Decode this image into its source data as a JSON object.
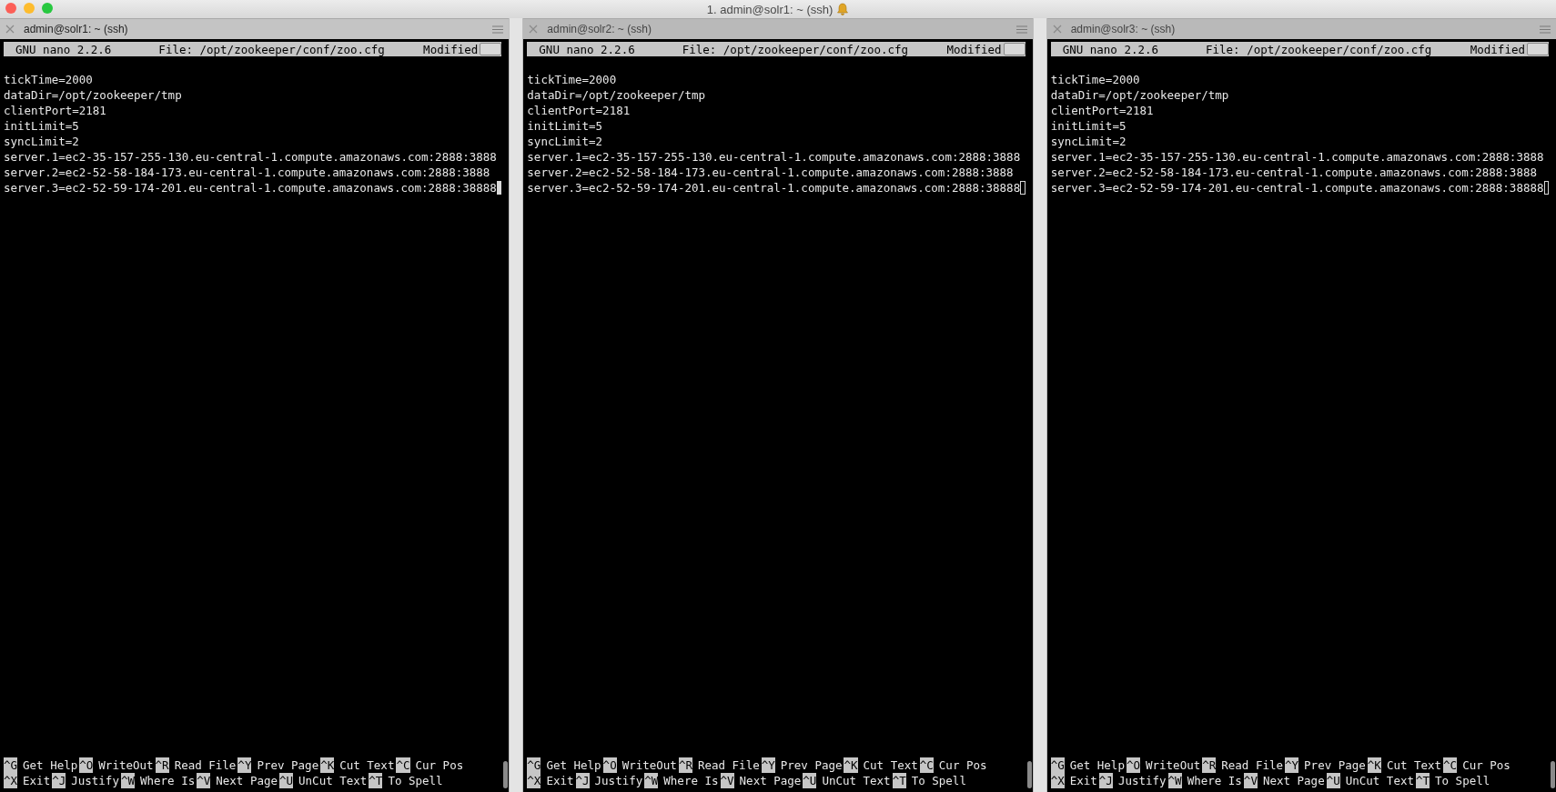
{
  "window": {
    "title": "1. admin@solr1: ~ (ssh)"
  },
  "panes": [
    {
      "tab": "admin@solr1: ~ (ssh)",
      "selected": true,
      "editor": {
        "version": "GNU nano 2.2.6",
        "file": "File: /opt/zookeeper/conf/zoo.cfg",
        "status": "Modified"
      },
      "lines": [
        "tickTime=2000",
        "dataDir=/opt/zookeeper/tmp",
        "clientPort=2181",
        "initLimit=5",
        "syncLimit=2",
        "server.1=ec2-35-157-255-130.eu-central-1.compute.amazonaws.com:2888:3888",
        "server.2=ec2-52-58-184-173.eu-central-1.compute.amazonaws.com:2888:3888",
        "server.3=ec2-52-59-174-201.eu-central-1.compute.amazonaws.com:2888:38888"
      ],
      "shortcuts": [
        [
          {
            "key": "^G",
            "label": "Get Help"
          },
          {
            "key": "^O",
            "label": "WriteOut"
          },
          {
            "key": "^R",
            "label": "Read File"
          },
          {
            "key": "^Y",
            "label": "Prev Page"
          },
          {
            "key": "^K",
            "label": "Cut Text"
          },
          {
            "key": "^C",
            "label": "Cur Pos"
          }
        ],
        [
          {
            "key": "^X",
            "label": "Exit"
          },
          {
            "key": "^J",
            "label": "Justify"
          },
          {
            "key": "^W",
            "label": "Where Is"
          },
          {
            "key": "^V",
            "label": "Next Page"
          },
          {
            "key": "^U",
            "label": "UnCut Text"
          },
          {
            "key": "^T",
            "label": "To Spell"
          }
        ]
      ]
    },
    {
      "tab": "admin@solr2: ~ (ssh)",
      "selected": false,
      "editor": {
        "version": "GNU nano 2.2.6",
        "file": "File: /opt/zookeeper/conf/zoo.cfg",
        "status": "Modified"
      },
      "lines": [
        "tickTime=2000",
        "dataDir=/opt/zookeeper/tmp",
        "clientPort=2181",
        "initLimit=5",
        "syncLimit=2",
        "server.1=ec2-35-157-255-130.eu-central-1.compute.amazonaws.com:2888:3888",
        "server.2=ec2-52-58-184-173.eu-central-1.compute.amazonaws.com:2888:3888",
        "server.3=ec2-52-59-174-201.eu-central-1.compute.amazonaws.com:2888:38888"
      ],
      "shortcuts": [
        [
          {
            "key": "^G",
            "label": "Get Help"
          },
          {
            "key": "^O",
            "label": "WriteOut"
          },
          {
            "key": "^R",
            "label": "Read File"
          },
          {
            "key": "^Y",
            "label": "Prev Page"
          },
          {
            "key": "^K",
            "label": "Cut Text"
          },
          {
            "key": "^C",
            "label": "Cur Pos"
          }
        ],
        [
          {
            "key": "^X",
            "label": "Exit"
          },
          {
            "key": "^J",
            "label": "Justify"
          },
          {
            "key": "^W",
            "label": "Where Is"
          },
          {
            "key": "^V",
            "label": "Next Page"
          },
          {
            "key": "^U",
            "label": "UnCut Text"
          },
          {
            "key": "^T",
            "label": "To Spell"
          }
        ]
      ]
    },
    {
      "tab": "admin@solr3: ~ (ssh)",
      "selected": false,
      "editor": {
        "version": "GNU nano 2.2.6",
        "file": "File: /opt/zookeeper/conf/zoo.cfg",
        "status": "Modified"
      },
      "lines": [
        "tickTime=2000",
        "dataDir=/opt/zookeeper/tmp",
        "clientPort=2181",
        "initLimit=5",
        "syncLimit=2",
        "server.1=ec2-35-157-255-130.eu-central-1.compute.amazonaws.com:2888:3888",
        "server.2=ec2-52-58-184-173.eu-central-1.compute.amazonaws.com:2888:3888",
        "server.3=ec2-52-59-174-201.eu-central-1.compute.amazonaws.com:2888:38888"
      ],
      "shortcuts": [
        [
          {
            "key": "^G",
            "label": "Get Help"
          },
          {
            "key": "^O",
            "label": "WriteOut"
          },
          {
            "key": "^R",
            "label": "Read File"
          },
          {
            "key": "^Y",
            "label": "Prev Page"
          },
          {
            "key": "^K",
            "label": "Cut Text"
          },
          {
            "key": "^C",
            "label": "Cur Pos"
          }
        ],
        [
          {
            "key": "^X",
            "label": "Exit"
          },
          {
            "key": "^J",
            "label": "Justify"
          },
          {
            "key": "^W",
            "label": "Where Is"
          },
          {
            "key": "^V",
            "label": "Next Page"
          },
          {
            "key": "^U",
            "label": "UnCut Text"
          },
          {
            "key": "^T",
            "label": "To Spell"
          }
        ]
      ]
    }
  ]
}
